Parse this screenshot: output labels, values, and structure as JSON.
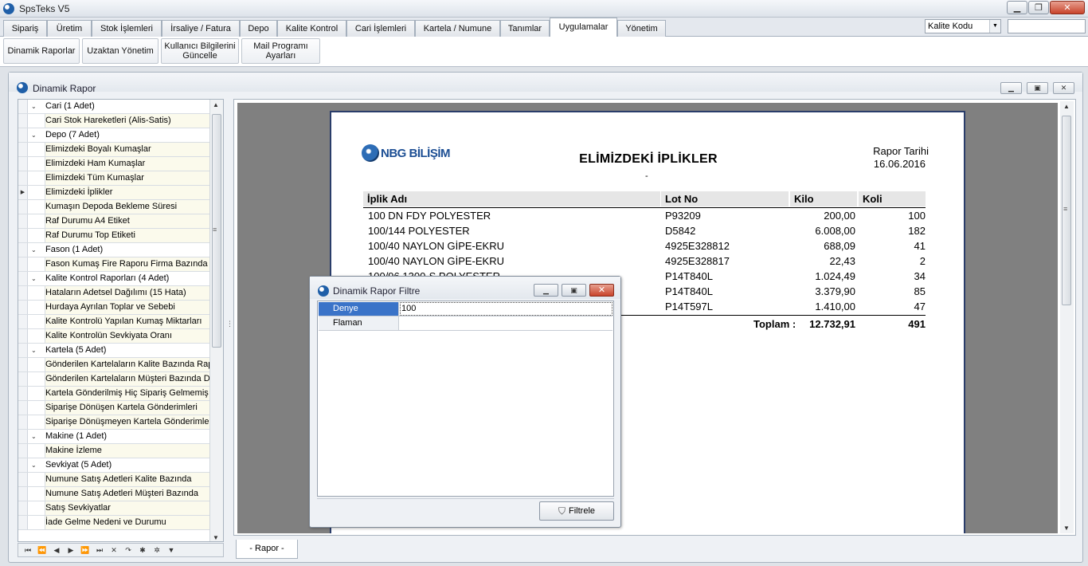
{
  "app": {
    "title": "SpsTeks V5"
  },
  "main_tabs": [
    "Sipariş",
    "Üretim",
    "Stok İşlemleri",
    "İrsaliye / Fatura",
    "Depo",
    "Kalite Kontrol",
    "Cari İşlemleri",
    "Kartela / Numune",
    "Tanımlar",
    "Uygulamalar",
    "Yönetim"
  ],
  "active_tab": "Uygulamalar",
  "top_select": {
    "value": "Kalite Kodu"
  },
  "ribbon": {
    "buttons": [
      "Dinamik Raporlar",
      "Uzaktan Yönetim",
      "Kullanıcı Bilgilerini Güncelle",
      "Mail Programı Ayarları"
    ],
    "b3_line1": "Kullanıcı Bilgilerini",
    "b3_line2": "Güncelle",
    "b4_line1": "Mail Programı",
    "b4_line2": "Ayarları"
  },
  "window": {
    "title": "Dinamik Rapor"
  },
  "tree": {
    "rows": [
      {
        "type": "group",
        "label": "Cari (1 Adet)"
      },
      {
        "type": "leaf",
        "label": "Cari Stok Hareketleri (Alis-Satis)"
      },
      {
        "type": "group",
        "label": "Depo (7 Adet)"
      },
      {
        "type": "leaf",
        "label": "Elimizdeki Boyalı Kumaşlar"
      },
      {
        "type": "leaf",
        "label": "Elimizdeki Ham Kumaşlar"
      },
      {
        "type": "leaf",
        "label": "Elimizdeki Tüm Kumaşlar"
      },
      {
        "type": "leaf",
        "label": "Elimizdeki İplikler",
        "current": true
      },
      {
        "type": "leaf",
        "label": "Kumaşın Depoda Bekleme Süresi"
      },
      {
        "type": "leaf",
        "label": "Raf Durumu A4 Etiket"
      },
      {
        "type": "leaf",
        "label": "Raf Durumu Top Etiketi"
      },
      {
        "type": "group",
        "label": "Fason (1 Adet)"
      },
      {
        "type": "leaf",
        "label": "Fason Kumaş Fire Raporu Firma Bazında"
      },
      {
        "type": "group",
        "label": "Kalite Kontrol Raporları (4 Adet)"
      },
      {
        "type": "leaf",
        "label": "Hataların Adetsel Dağılımı (15 Hata)"
      },
      {
        "type": "leaf",
        "label": "Hurdaya Ayrılan Toplar ve Sebebi"
      },
      {
        "type": "leaf",
        "label": "Kalite Kontrolü Yapılan Kumaş Miktarları"
      },
      {
        "type": "leaf",
        "label": "Kalite Kontrolün Sevkiyata Oranı"
      },
      {
        "type": "group",
        "label": "Kartela (5 Adet)"
      },
      {
        "type": "leaf",
        "label": "Gönderilen Kartelaların Kalite Bazında Rapo"
      },
      {
        "type": "leaf",
        "label": "Gönderilen Kartelaların Müşteri Bazında Dağ"
      },
      {
        "type": "leaf",
        "label": "Kartela Gönderilmiş Hiç Sipariş Gelmemiş Mü"
      },
      {
        "type": "leaf",
        "label": "Siparişe Dönüşen Kartela Gönderimleri"
      },
      {
        "type": "leaf",
        "label": "Siparişe Dönüşmeyen Kartela Gönderimleri"
      },
      {
        "type": "group",
        "label": "Makine (1 Adet)"
      },
      {
        "type": "leaf",
        "label": "Makine İzleme"
      },
      {
        "type": "group",
        "label": "Sevkiyat (5 Adet)"
      },
      {
        "type": "leaf",
        "label": "Numune Satış Adetleri Kalite Bazında"
      },
      {
        "type": "leaf",
        "label": "Numune Satış Adetleri Müşteri Bazında"
      },
      {
        "type": "leaf",
        "label": "Satış Sevkiyatlar"
      },
      {
        "type": "leaf",
        "label": "İade Gelme Nedeni ve Durumu"
      }
    ]
  },
  "report": {
    "logo_text": "NBG BİLİŞİM",
    "title": "ELİMİZDEKİ İPLİKLER",
    "dash": "-",
    "date_label": "Rapor Tarihi",
    "date_value": "16.06.2016",
    "headers": [
      "İplik Adı",
      "Lot No",
      "Kilo",
      "Koli"
    ],
    "rows": [
      [
        "100 DN FDY POLYESTER",
        "P93209",
        "200,00",
        "100"
      ],
      [
        "100/144 POLYESTER",
        "D5842",
        "6.008,00",
        "182"
      ],
      [
        "100/40 NAYLON GİPE-EKRU",
        "4925E328812",
        "688,09",
        "41"
      ],
      [
        "100/40 NAYLON GİPE-EKRU",
        "4925E328817",
        "22,43",
        "2"
      ],
      [
        "100/96 1300-S POLYESTER",
        "P14T840L",
        "1.024,49",
        "34"
      ],
      [
        "",
        "P14T840L",
        "3.379,90",
        "85"
      ],
      [
        "",
        "P14T597L",
        "1.410,00",
        "47"
      ]
    ],
    "total_label": "Toplam  :",
    "total_kilo": "12.732,91",
    "total_koli": "491",
    "tab_label": "-  Rapor  -"
  },
  "filter_dialog": {
    "title": "Dinamik Rapor Filtre",
    "rows": [
      {
        "key": "Denye",
        "value": "100"
      },
      {
        "key": "Flaman",
        "value": ""
      }
    ],
    "button": "Filtrele"
  }
}
